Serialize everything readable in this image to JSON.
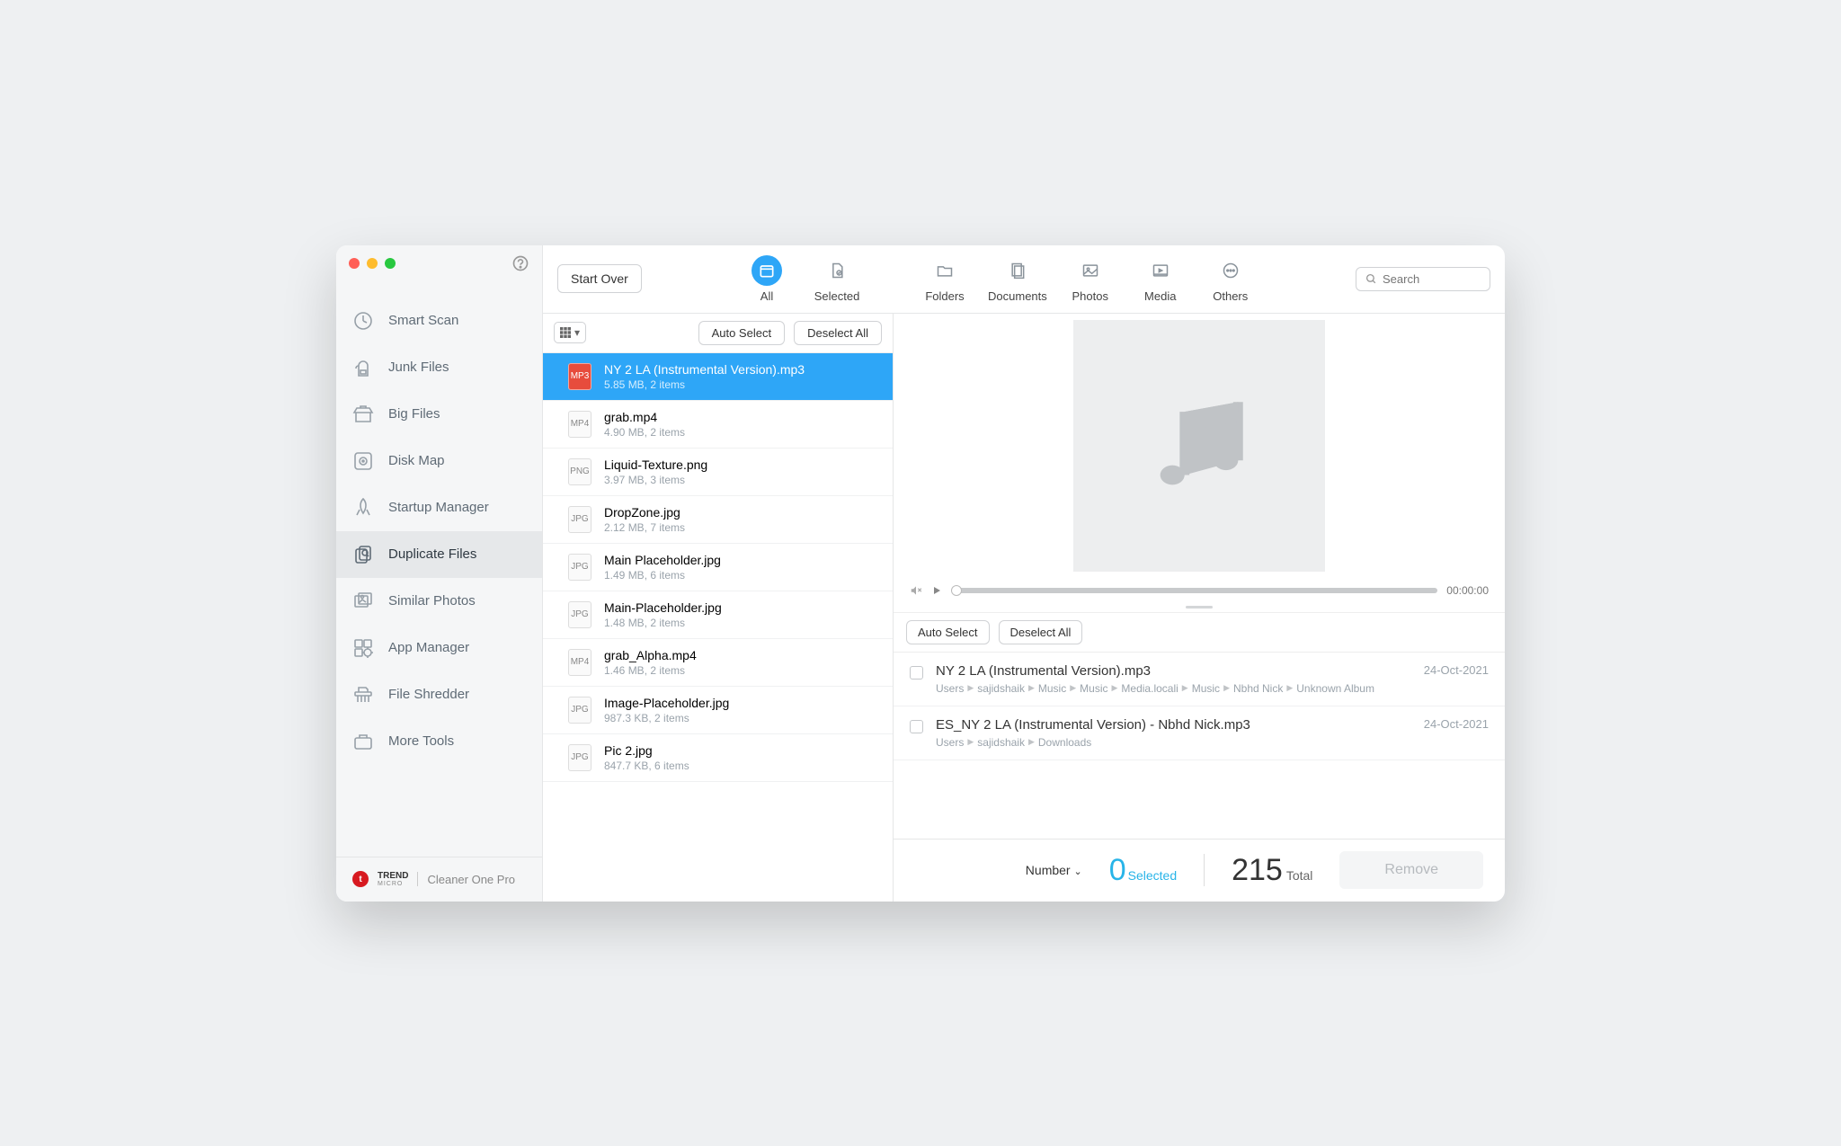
{
  "sidebar": {
    "items": [
      {
        "label": "Smart Scan",
        "icon": "smart-scan-icon"
      },
      {
        "label": "Junk Files",
        "icon": "junk-files-icon"
      },
      {
        "label": "Big Files",
        "icon": "big-files-icon"
      },
      {
        "label": "Disk Map",
        "icon": "disk-map-icon"
      },
      {
        "label": "Startup Manager",
        "icon": "startup-icon"
      },
      {
        "label": "Duplicate Files",
        "icon": "duplicate-files-icon"
      },
      {
        "label": "Similar Photos",
        "icon": "similar-photos-icon"
      },
      {
        "label": "App Manager",
        "icon": "app-manager-icon"
      },
      {
        "label": "File Shredder",
        "icon": "file-shredder-icon"
      },
      {
        "label": "More Tools",
        "icon": "more-tools-icon"
      }
    ]
  },
  "brand": {
    "vendor_top": "TREND",
    "vendor_bottom": "MICRO",
    "product": "Cleaner One Pro"
  },
  "toolbar": {
    "start_over": "Start Over",
    "tabs": [
      {
        "label": "All"
      },
      {
        "label": "Selected"
      },
      {
        "label": "Folders"
      },
      {
        "label": "Documents"
      },
      {
        "label": "Photos"
      },
      {
        "label": "Media"
      },
      {
        "label": "Others"
      }
    ],
    "search_placeholder": "Search"
  },
  "list_toolbar": {
    "auto_select": "Auto Select",
    "deselect_all": "Deselect All"
  },
  "files": [
    {
      "name": "NY 2 LA (Instrumental Version).mp3",
      "meta": "5.85 MB, 2 items",
      "type": "mp3"
    },
    {
      "name": "grab.mp4",
      "meta": "4.90 MB, 2 items",
      "type": "mp4"
    },
    {
      "name": "Liquid-Texture.png",
      "meta": "3.97 MB, 3 items",
      "type": "png"
    },
    {
      "name": "DropZone.jpg",
      "meta": "2.12 MB, 7 items",
      "type": "jpg"
    },
    {
      "name": "Main Placeholder.jpg",
      "meta": "1.49 MB, 6 items",
      "type": "jpg"
    },
    {
      "name": "Main-Placeholder.jpg",
      "meta": "1.48 MB, 2 items",
      "type": "jpg"
    },
    {
      "name": "grab_Alpha.mp4",
      "meta": "1.46 MB, 2 items",
      "type": "mp4"
    },
    {
      "name": "Image-Placeholder.jpg",
      "meta": "987.3 KB, 2 items",
      "type": "jpg"
    },
    {
      "name": "Pic 2.jpg",
      "meta": "847.7 KB, 6 items",
      "type": "jpg"
    }
  ],
  "player": {
    "time": "00:00:00"
  },
  "dup_toolbar": {
    "auto_select": "Auto Select",
    "deselect_all": "Deselect All"
  },
  "duplicates": [
    {
      "name": "NY 2 LA (Instrumental Version).mp3",
      "date": "24-Oct-2021",
      "path": [
        "Users",
        "sajidshaik",
        "Music",
        "Music",
        "Media.locali",
        "Music",
        "Nbhd Nick",
        "Unknown Album"
      ]
    },
    {
      "name": "ES_NY 2 LA (Instrumental Version) - Nbhd Nick.mp3",
      "date": "24-Oct-2021",
      "path": [
        "Users",
        "sajidshaik",
        "Downloads"
      ]
    }
  ],
  "footer": {
    "sort_label": "Number",
    "selected_count": "0",
    "selected_label": "Selected",
    "total_count": "215",
    "total_label": "Total",
    "remove": "Remove"
  }
}
